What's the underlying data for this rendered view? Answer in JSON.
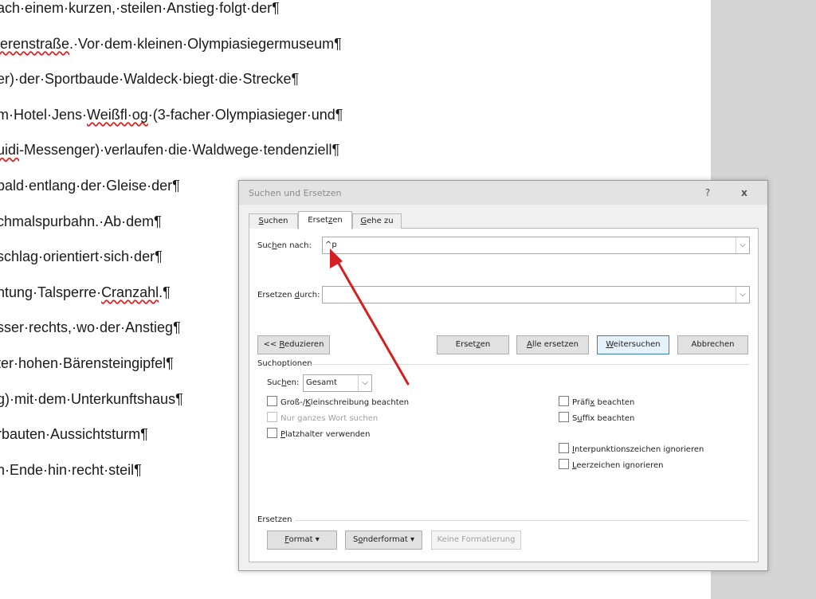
{
  "document": {
    "lines": [
      [
        {
          "t": "ach·einem·kurzen,·steilen·Anstieg·folgt·der¶"
        }
      ],
      [
        {
          "t": "ierenstraße",
          "sq": true
        },
        {
          "t": ".·Vor·dem·kleinen·Olympiasiegermuseum¶"
        }
      ],
      [
        {
          "t": "er)·der·Sportbaude·Waldeck·biegt·die·Strecke¶"
        }
      ],
      [
        {
          "t": "m·Hotel·Jens·"
        },
        {
          "t": "Weißfl·og",
          "sq": true
        },
        {
          "t": "·(3-facher·Olympiasieger·und¶"
        }
      ],
      [
        {
          "t": "uidi",
          "sq": true
        },
        {
          "t": "-Messenger)·verlaufen·die·Waldwege·tendenziell¶"
        }
      ],
      [
        {
          "t": "bald·entlang·der·Gleise·der¶"
        }
      ],
      [
        {
          "t": "chmalspurbahn.·Ab·dem¶"
        }
      ],
      [
        {
          "t": "schlag·orientiert·sich·der¶"
        }
      ],
      [
        {
          "t": "htung·Talsperre·"
        },
        {
          "t": "Cranzahl",
          "sq": true
        },
        {
          "t": ".¶"
        }
      ],
      [
        {
          "t": "sser·rechts,·wo·der·Anstieg¶"
        }
      ],
      [
        {
          "t": "ter·hohen·Bärensteingipfel¶"
        }
      ],
      [
        {
          "t": "g)·mit·dem·Unterkunftshaus¶"
        }
      ],
      [
        {
          "t": "rbauten·Aussichtsturm¶"
        }
      ],
      [
        {
          "t": "n·Ende·hin·recht·steil¶"
        }
      ]
    ]
  },
  "dialog": {
    "title": "Suchen und Ersetzen",
    "help": "?",
    "close": "x",
    "tabs": [
      {
        "pre": "",
        "u": "S",
        "post": "uchen"
      },
      {
        "pre": "Erset",
        "u": "z",
        "post": "en"
      },
      {
        "pre": "",
        "u": "G",
        "post": "ehe zu"
      }
    ],
    "find_label": {
      "pre": "Suc",
      "u": "h",
      "post": "en nach:"
    },
    "find_value": "^p",
    "replace_label": {
      "pre": "Ersetzen ",
      "u": "d",
      "post": "urch:"
    },
    "replace_value": "",
    "buttons": {
      "less": {
        "pre": "<< ",
        "u": "R",
        "post": "eduzieren"
      },
      "replace": {
        "pre": "Erset",
        "u": "z",
        "post": "en"
      },
      "replace_all": {
        "pre": "",
        "u": "A",
        "post": "lle ersetzen"
      },
      "find_next": {
        "pre": "",
        "u": "W",
        "post": "eitersuchen"
      },
      "cancel": {
        "pre": "Abbrechen",
        "u": "",
        "post": ""
      }
    },
    "options_label": "Suchoptionen",
    "search_label": {
      "pre": "Suc",
      "u": "h",
      "post": "en:"
    },
    "search_value": "Gesamt",
    "checkboxes_left": [
      {
        "pre": "Groß-/",
        "u": "K",
        "post": "leinschreibung beachten",
        "disabled": false
      },
      {
        "pre": "Nur ganzes Wort suchen",
        "u": "",
        "post": "",
        "disabled": true
      },
      {
        "pre": "",
        "u": "P",
        "post": "latzhalter verwenden",
        "disabled": false
      }
    ],
    "checkboxes_right": [
      {
        "pre": "Präfi",
        "u": "x",
        "post": " beachten"
      },
      {
        "pre": "S",
        "u": "u",
        "post": "ffix beachten"
      },
      {
        "pre": "",
        "u": "I",
        "post": "nterpunktionszeichen ignorieren"
      },
      {
        "pre": "",
        "u": "L",
        "post": "eerzeichen ignorieren"
      }
    ],
    "replace_section": "Ersetzen",
    "format_buttons": {
      "format": {
        "pre": "",
        "u": "F",
        "post": "ormat ▾"
      },
      "special": {
        "pre": "S",
        "u": "o",
        "post": "nderformat ▾"
      },
      "noformat": {
        "pre": "Keine Formatierung",
        "u": "",
        "post": ""
      }
    }
  },
  "annotation": {
    "color": "#d42020"
  }
}
